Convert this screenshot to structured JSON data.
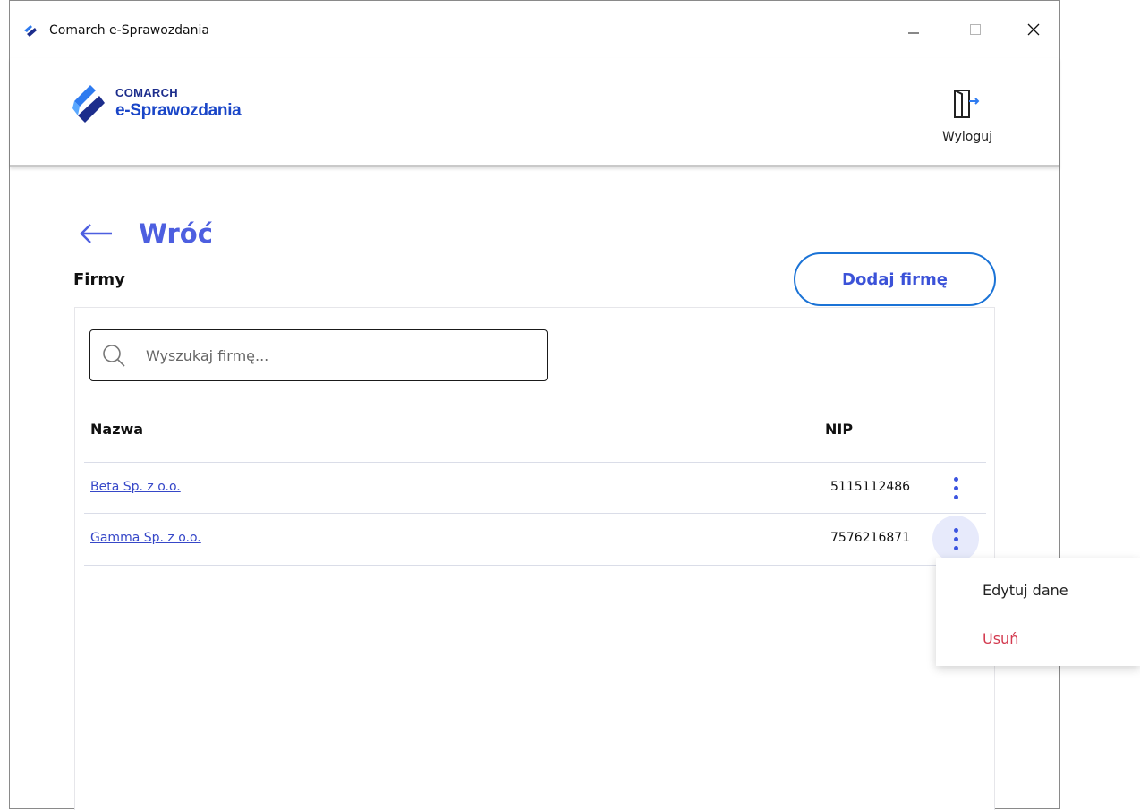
{
  "window": {
    "title": "Comarch e-Sprawozdania"
  },
  "brand": {
    "top": "COMARCH",
    "bottom": "e-Sprawozdania"
  },
  "header": {
    "logout_label": "Wyloguj"
  },
  "nav": {
    "back_label": "Wróć"
  },
  "section": {
    "title": "Firmy",
    "add_button": "Dodaj firmę"
  },
  "search": {
    "placeholder": "Wyszukaj firmę...",
    "value": ""
  },
  "table": {
    "headers": {
      "name": "Nazwa",
      "nip": "NIP"
    },
    "rows": [
      {
        "name": "Beta Sp. z o.o.",
        "nip": "5115112486"
      },
      {
        "name": "Gamma Sp. z o.o.",
        "nip": "7576216871"
      }
    ]
  },
  "context_menu": {
    "edit": "Edytuj dane",
    "delete": "Usuń"
  },
  "colors": {
    "accent": "#4d5fe0",
    "link": "#3647c8",
    "danger": "#d33a4f",
    "button_border": "#1b73d6"
  }
}
